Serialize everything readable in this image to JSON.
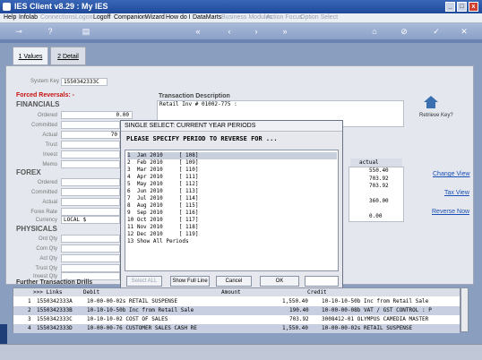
{
  "window": {
    "title": "IES Client v8.29 : My IES",
    "min": "_",
    "max": "□",
    "close": "x"
  },
  "menu": [
    {
      "label": "Help",
      "enabled": true
    },
    {
      "label": "Infolab",
      "enabled": true
    },
    {
      "label": "Connections",
      "enabled": false
    },
    {
      "label": "Logon",
      "enabled": false
    },
    {
      "label": "Logoff",
      "enabled": true
    },
    {
      "label": "Companion",
      "enabled": true
    },
    {
      "label": "Wizard",
      "enabled": true
    },
    {
      "label": "How do I",
      "enabled": true
    },
    {
      "label": "DataMarts",
      "enabled": true
    },
    {
      "label": "Business Modules",
      "enabled": false
    },
    {
      "label": "Action Focus",
      "enabled": false
    },
    {
      "label": "Option Select",
      "enabled": false
    }
  ],
  "tabs": {
    "values": "1 Values",
    "detail": "2 Detail"
  },
  "form": {
    "system_key_label": "System Key",
    "system_key_value": "1550342333C",
    "forced_reversals": "Forced Reversals: -",
    "financials": "FINANCIALS",
    "fin_labels": [
      "Ordered",
      "Committed",
      "Actual",
      "Trust",
      "Invest",
      "Memo"
    ],
    "fin_values": [
      "0.00",
      "",
      "70",
      "",
      "",
      ""
    ],
    "forex": "FOREX",
    "forex_labels": [
      "Ordered",
      "Committed",
      "Actual",
      "Forex Rate",
      "Currency"
    ],
    "currency_value": "LOCAL $",
    "physicals": "PHYSICALS",
    "phys_labels": [
      "Ord Qty",
      "Com Qty",
      "Act Qty",
      "Trust Qty",
      "Invest Qty"
    ],
    "txn_desc_label": "Transaction Description",
    "txn_desc_value": "Retail Inv # 01002-775 :",
    "right_col_header": "actual",
    "right_col_values": [
      "550.40",
      "703.92",
      "703.92",
      "",
      "360.00",
      "",
      "0.00"
    ],
    "retrieve_key": "Retrieve Key?",
    "links": [
      "Change View",
      "Tax View",
      "Reverse Now"
    ]
  },
  "dialog": {
    "title": "SINGLE SELECT: CURRENT YEAR PERIODS",
    "heading": "PLEASE SPECIFY PERIOD TO REVERSE FOR ...",
    "items": [
      "1  Jan 2010     [ 108]",
      "2  Feb 2010     [ 109]",
      "3  Mar 2010     [ 110]",
      "4  Apr 2010     [ 111]",
      "5  May 2010     [ 112]",
      "6  Jun 2010     [ 113]",
      "7  Jul 2010     [ 114]",
      "8  Aug 2010     [ 115]",
      "9  Sep 2010     [ 116]",
      "10 Oct 2010     [ 117]",
      "11 Nov 2010     [ 118]",
      "12 Dec 2010     [ 119]",
      "13 Show All Periods"
    ],
    "selected_index": 0,
    "buttons": {
      "select_all": "Select ALL",
      "show_full": "Show Full Line",
      "cancel": "Cancel",
      "ok": "OK"
    }
  },
  "drills": {
    "title": "Further Transaction Drills",
    "headers": [
      ">>> Links",
      "Debit",
      "Amount",
      "Credit"
    ],
    "rows": [
      {
        "n": "1",
        "link": "1550342333A",
        "debit": "10-00-00-02s RETAIL SUSPENSE",
        "amount": "1,550.40",
        "credit": "10-10-10-50b Inc from Retail Sale"
      },
      {
        "n": "2",
        "link": "1550342333B",
        "debit": "10-10-10-50b Inc from Retail Sale",
        "amount": "190.40",
        "credit": "10-00-00-08b VAT / GST CONTROL : P"
      },
      {
        "n": "3",
        "link": "1550342333C",
        "debit": "10-10-10-02 COST OF SALES",
        "amount": "703.92",
        "credit": "3008412-01 OLYMPUS CAMEDIA MASTER"
      },
      {
        "n": "4",
        "link": "1550342333D",
        "debit": "10-00-00-76 CUSTOMER SALES CASH RE",
        "amount": "1,550.40",
        "credit": "10-00-00-02s RETAIL SUSPENSE"
      }
    ]
  },
  "colors": {
    "forced_reversals": "#c81010",
    "link": "#1a4fb5",
    "titlebar": "#2a58a8"
  }
}
